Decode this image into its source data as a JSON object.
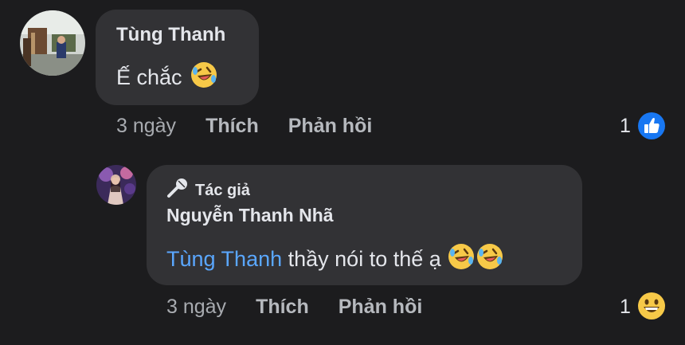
{
  "comment": {
    "author": "Tùng Thanh",
    "text": "Ế chắc",
    "emoji": "rofl-emoji",
    "time": "3 ngày",
    "like_label": "Thích",
    "reply_label": "Phản hồi",
    "reaction_count": "1",
    "reaction_icon": "like-reaction-icon"
  },
  "reply": {
    "badge": "Tác giả",
    "badge_icon": "microphone-icon",
    "author": "Nguyễn Thanh Nhã",
    "mention": "Tùng Thanh",
    "text": " thầy nói to thế ạ",
    "emojis": [
      "rofl-emoji",
      "rofl-emoji"
    ],
    "time": "3 ngày",
    "like_label": "Thích",
    "reply_label": "Phản hồi",
    "reaction_count": "1",
    "reaction_icon": "grin-reaction-icon"
  },
  "colors": {
    "background": "#1c1c1e",
    "bubble": "#323235",
    "mention": "#5aa7ff",
    "like_blue": "#1877f2",
    "emoji_yellow": "#f7c948"
  }
}
